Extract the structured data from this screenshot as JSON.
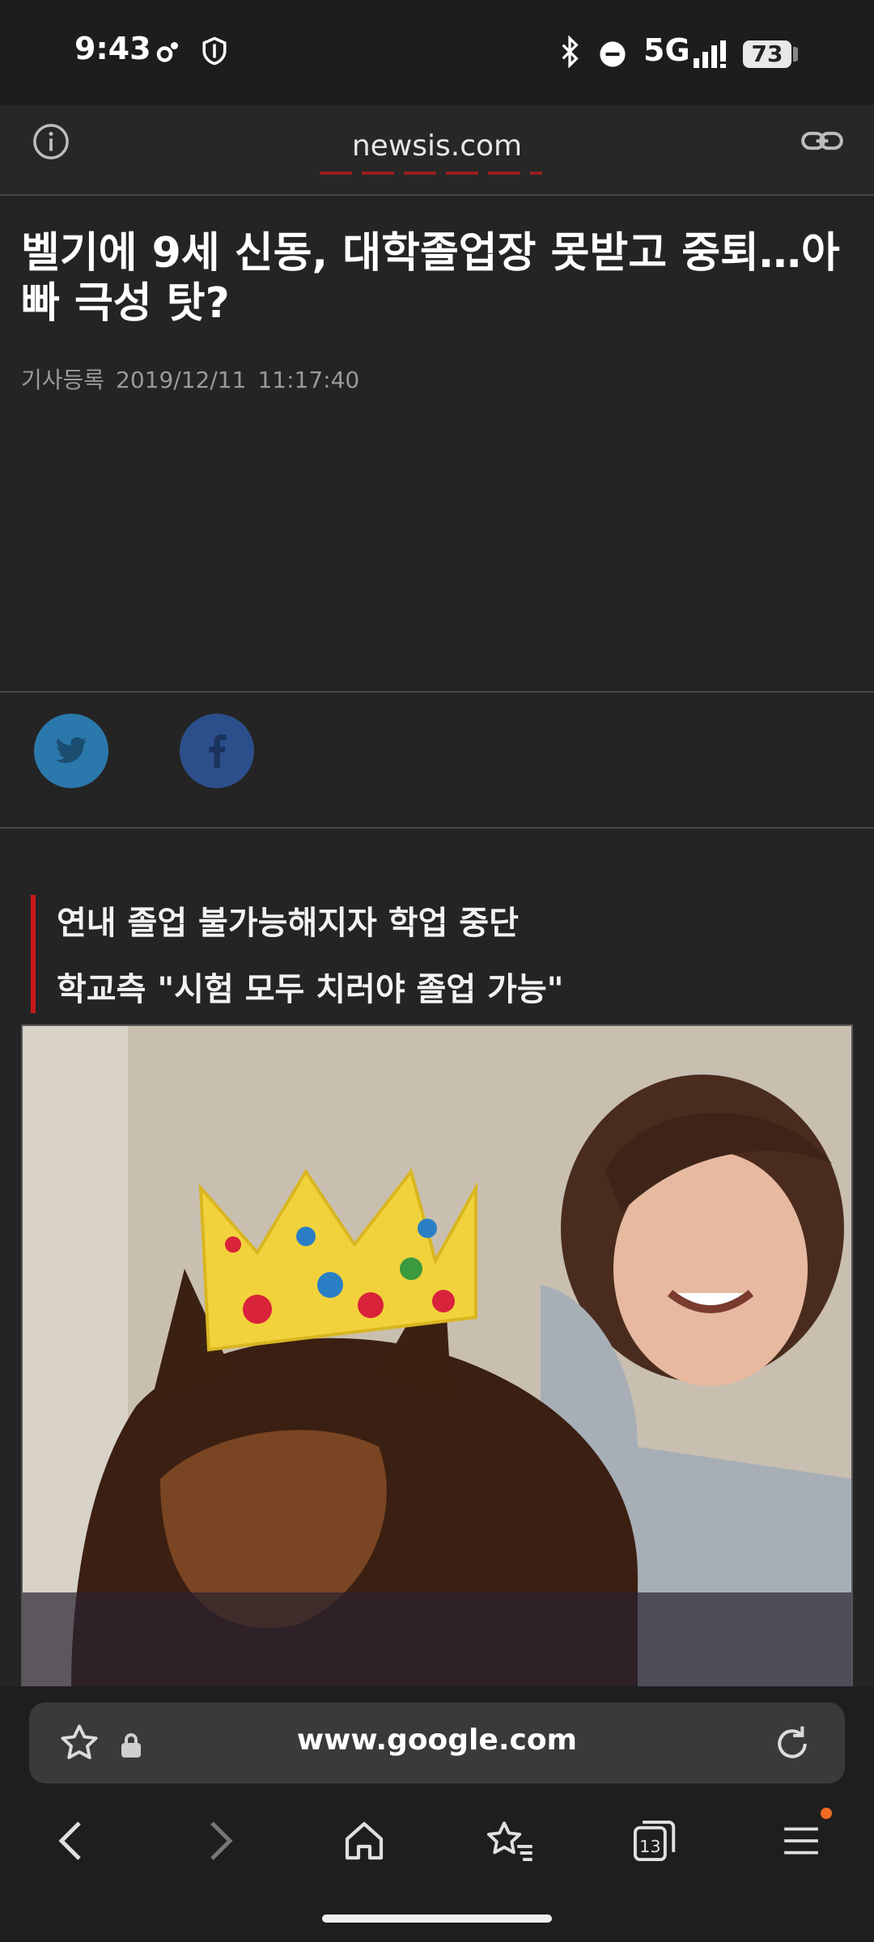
{
  "status_bar": {
    "time": "9:43",
    "network": "5G",
    "battery": "73"
  },
  "top_bar": {
    "domain": "newsis.com"
  },
  "article": {
    "headline": "벨기에 9세 신동, 대학졸업장 못받고 중퇴…아빠 극성 탓?",
    "meta_label": "기사등록",
    "meta_date": "2019/12/11",
    "meta_time": "11:17:40",
    "summary": [
      "연내 졸업 불가능해지자 학업 중단",
      "학교측 \"시험 모두 치러야 졸업 가능\""
    ]
  },
  "browser": {
    "url": "www.google.com",
    "tab_count": "13"
  },
  "colors": {
    "accent_red": "#c91a1a",
    "twitter": "#2b78ac",
    "facebook": "#2c4f8c",
    "notification_dot": "#f06a24"
  }
}
